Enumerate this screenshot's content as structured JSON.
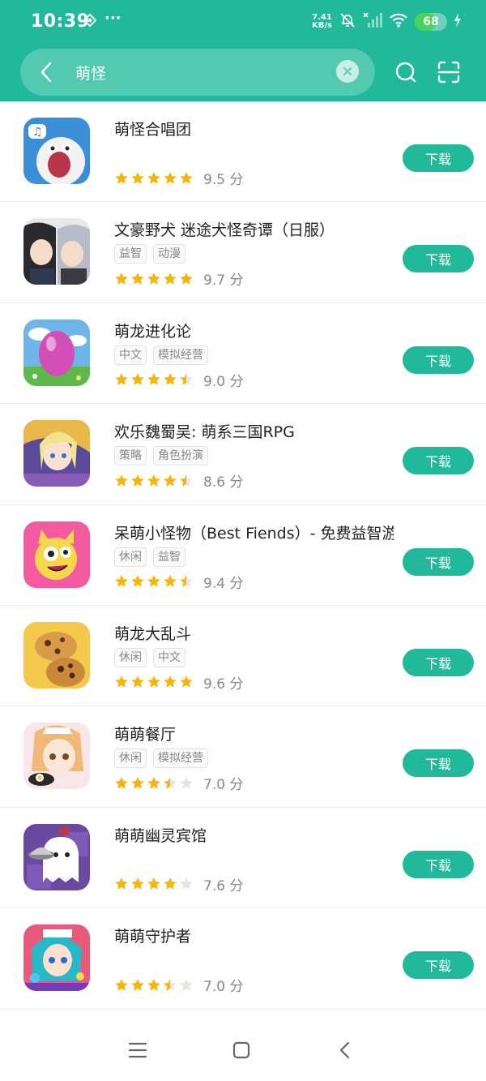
{
  "status_bar": {
    "time": "10:39",
    "more": "···",
    "net_speed_value": "7.41",
    "net_speed_unit": "KB/s",
    "battery_level": "68",
    "battery_fraction": 0.68
  },
  "search": {
    "query": "萌怪"
  },
  "colors": {
    "brand": "#21b99a",
    "star_filled": "#f5b50a",
    "star_empty": "#e5e5e5"
  },
  "apps": [
    {
      "name": "萌怪合唱团",
      "tags": [],
      "rating": 5,
      "score": "9.5 分",
      "button": "下载",
      "icon": "monster-choir-icon"
    },
    {
      "name": "文豪野犬 迷途犬怪奇谭（日服）",
      "tags": [
        "益智",
        "动漫"
      ],
      "rating": 5,
      "score": "9.7 分",
      "button": "下载",
      "icon": "anime-characters-icon"
    },
    {
      "name": "萌龙进化论",
      "tags": [
        "中文",
        "模拟经营"
      ],
      "rating": 4.5,
      "score": "9.0 分",
      "button": "下载",
      "icon": "dragon-egg-icon"
    },
    {
      "name": "欢乐魏蜀吴: 萌系三国RPG",
      "tags": [
        "策略",
        "角色扮演"
      ],
      "rating": 4.5,
      "score": "8.6 分",
      "button": "下载",
      "icon": "three-kingdoms-icon"
    },
    {
      "name": "呆萌小怪物（Best Fiends）- 免费益智游戏",
      "tags": [
        "休闲",
        "益智"
      ],
      "rating": 4.5,
      "score": "9.4 分",
      "button": "下载",
      "icon": "best-fiends-icon"
    },
    {
      "name": "萌龙大乱斗",
      "tags": [
        "休闲",
        "中文"
      ],
      "rating": 5,
      "score": "9.6 分",
      "button": "下载",
      "icon": "cookie-icon"
    },
    {
      "name": "萌萌餐厅",
      "tags": [
        "休闲",
        "模拟经营"
      ],
      "rating": 3.5,
      "score": "7.0 分",
      "button": "下载",
      "icon": "restaurant-girl-icon"
    },
    {
      "name": "萌萌幽灵宾馆",
      "tags": [],
      "rating": 4,
      "score": "7.6 分",
      "button": "下载",
      "icon": "ghost-hotel-icon"
    },
    {
      "name": "萌萌守护者",
      "tags": [],
      "rating": 3.5,
      "score": "7.0 分",
      "button": "下载",
      "icon": "guardian-girl-icon"
    }
  ]
}
